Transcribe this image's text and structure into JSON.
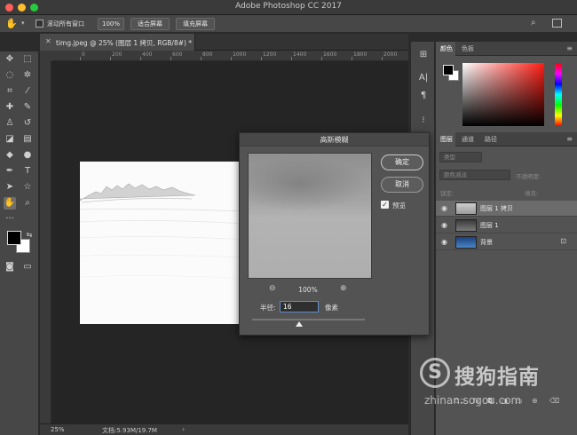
{
  "app": {
    "title": "Adobe Photoshop CC 2017"
  },
  "options_bar": {
    "scroll_all_windows": "滚动所有窗口",
    "zoom_100": "100%",
    "fit_screen": "适合屏幕",
    "fill_screen": "填充屏幕"
  },
  "document": {
    "tab_label": "timg.jpeg @ 25% (图层 1 拷贝, RGB/8#) *",
    "ruler_ticks": [
      "0",
      "200",
      "400",
      "600",
      "800",
      "1000",
      "1200",
      "1400",
      "1600",
      "1800",
      "2000"
    ]
  },
  "status_bar": {
    "zoom": "25%",
    "doc_size": "文档:5.93M/19.7M"
  },
  "color_panel": {
    "tabs": [
      "颜色",
      "色板"
    ],
    "foreground": "#000000",
    "background": "#ffffff"
  },
  "layers_panel": {
    "tabs": [
      "图层",
      "通道",
      "路径"
    ],
    "filter_kind": "类型",
    "blend_mode": "颜色减淡",
    "opacity_label": "不透明度:",
    "lock_label": "锁定:",
    "fill_label": "填充:",
    "layers": [
      {
        "name": "图层 1 拷贝",
        "selected": true,
        "locked": false
      },
      {
        "name": "图层 1",
        "selected": false,
        "locked": false
      },
      {
        "name": "背景",
        "selected": false,
        "locked": true
      }
    ]
  },
  "dialog": {
    "title": "高斯模糊",
    "ok": "确定",
    "cancel": "取消",
    "preview_label": "预览",
    "preview_checked": true,
    "zoom": "100%",
    "radius_label": "半径:",
    "radius_value": "16",
    "radius_unit": "像素"
  },
  "watermark": {
    "logo_letter": "S",
    "text": "搜狗指南",
    "url": "zhinan.sogou.com"
  }
}
